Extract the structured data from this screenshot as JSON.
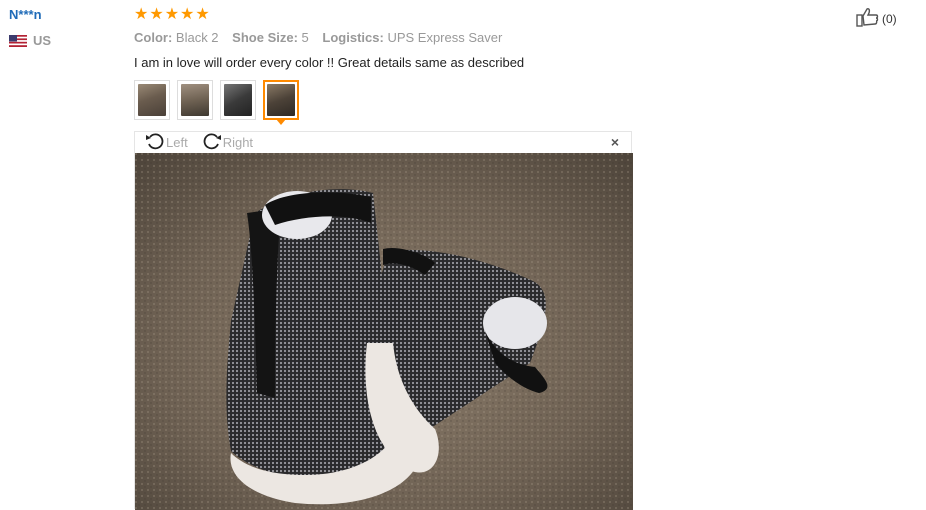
{
  "reviewer": {
    "name": "N***n",
    "country": "US"
  },
  "rating": {
    "stars": 5,
    "max": 5
  },
  "attributes": [
    {
      "key": "Color:",
      "value": "Black 2"
    },
    {
      "key": "Shoe Size:",
      "value": "5"
    },
    {
      "key": "Logistics:",
      "value": "UPS Express Saver"
    }
  ],
  "review_text": "I am in love will order every color !! Great details same as described",
  "thumbnails": [
    {
      "id": 1,
      "active": false
    },
    {
      "id": 2,
      "active": false
    },
    {
      "id": 3,
      "active": false
    },
    {
      "id": 4,
      "active": true
    }
  ],
  "viewer": {
    "rotate_left": "Left",
    "rotate_right": "Right",
    "close": "×"
  },
  "helpful": {
    "count": "(0)"
  },
  "colors": {
    "accent": "#ff8a00",
    "star": "#ff9900",
    "username": "#1f6bb8"
  }
}
